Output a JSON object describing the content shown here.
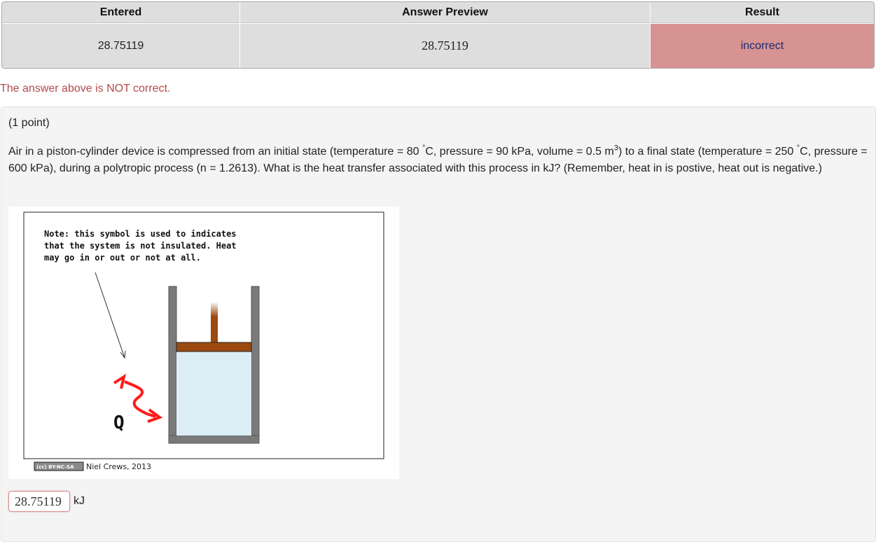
{
  "results_table": {
    "headers": [
      "Entered",
      "Answer Preview",
      "Result"
    ],
    "row": {
      "entered": "28.75119",
      "preview": "28.75119",
      "result": "incorrect"
    }
  },
  "feedback": {
    "message": "The answer above is NOT correct."
  },
  "problem": {
    "points": "(1 point)",
    "question_part1": "Air in a piston-cylinder device is compressed from an initial state (temperature = 80",
    "question_part2": "C, pressure = 90 kPa, volume = 0.5 m",
    "question_part3": ") to a final state (temperature = 250",
    "question_part4": "C, pressure = 600 kPa), during a polytropic process (n = 1.2613). What is the heat transfer associated with this process in kJ? (Remember, heat in is postive, heat out is negative.)",
    "degree_symbol": "°",
    "cube_exponent": "3",
    "figure": {
      "note_line1": "Note: this symbol is used to indicates",
      "note_line2": "that the system is not insulated. Heat",
      "note_line3": "may go in or out or not at all.",
      "heat_label": "Q",
      "license_badge": "(cc) BY-NC-SA",
      "credit": "Niel Crews, 2013"
    },
    "answer": {
      "value": "28.75119",
      "unit": "kJ"
    }
  },
  "colors": {
    "incorrect_bg": "#d69392",
    "error_text": "#b34a4a",
    "piston": "#9c4a0e",
    "gas": "#dceef5",
    "arrow": "#ff1a1a"
  }
}
